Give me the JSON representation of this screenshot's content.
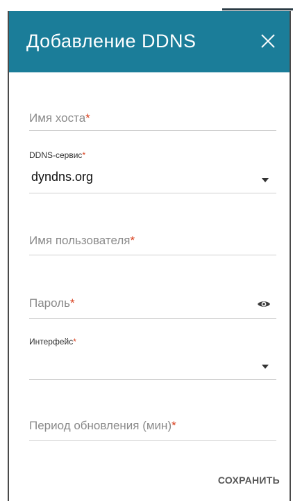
{
  "dialog": {
    "title": "Добавление DDNS",
    "save_label": "СОХРАНИТЬ"
  },
  "fields": {
    "hostname": {
      "placeholder": "Имя хоста",
      "required_mark": "*"
    },
    "ddns_service": {
      "label": "DDNS-сервис",
      "required_mark": "*",
      "value": "dyndns.org"
    },
    "username": {
      "placeholder": "Имя пользователя",
      "required_mark": "*"
    },
    "password": {
      "placeholder": "Пароль",
      "required_mark": "*"
    },
    "interface": {
      "label": "Интерфейс",
      "required_mark": "*",
      "value": ""
    },
    "update_period": {
      "placeholder": "Период обновления (мин)",
      "required_mark": "*"
    }
  },
  "icons": {
    "close": "close-icon",
    "dropdown": "chevron-down-icon",
    "show_password": "eye-icon"
  },
  "colors": {
    "header": "#1b7d99",
    "required": "#d8401e",
    "underline": "#cfcfcf"
  }
}
